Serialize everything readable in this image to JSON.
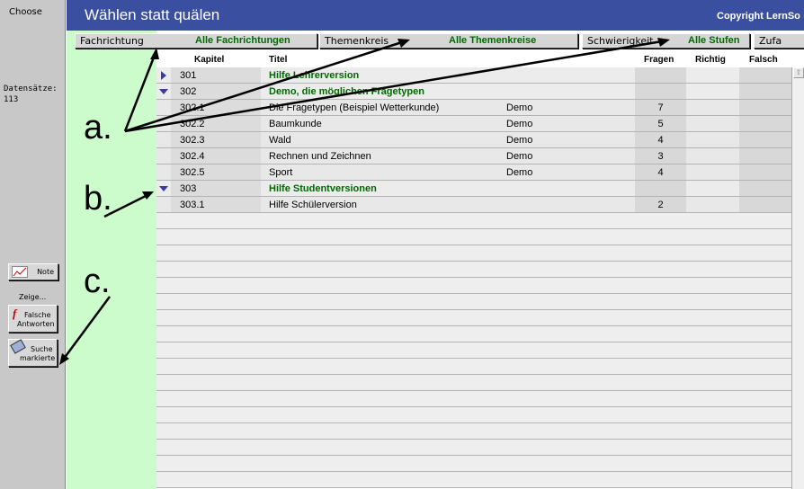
{
  "sidebar": {
    "choose": "Choose",
    "datasaetze_label": "Datensätze:",
    "datasaetze_value": "113",
    "note_label": "Note",
    "zeige_label": "Zeige...",
    "falsche_line1": "Falsche",
    "falsche_line2": "Antworten",
    "suche_line1": "Suche",
    "suche_line2": "markierte"
  },
  "header": {
    "title": "Wählen statt quälen",
    "copyright": "Copyright LernSo"
  },
  "filters": {
    "fachrichtung_label": "Fachrichtung",
    "fachrichtung_value": "Alle Fachrichtungen",
    "themenkreis_label": "Themenkreis",
    "themenkreis_value": "Alle Themenkreise",
    "schwierigkeit_label": "Schwierigkeit",
    "schwierigkeit_value": "Alle Stufen",
    "zufall_label": "Zufa"
  },
  "table": {
    "columns": {
      "kapitel": "Kapitel",
      "titel": "Titel",
      "fragen": "Fragen",
      "richtig": "Richtig",
      "falsch": "Falsch"
    },
    "rows": [
      {
        "kapitel": "301",
        "titel": "Hilfe Lehrerversion",
        "typ": "",
        "fragen": "",
        "group": true,
        "expanded": false
      },
      {
        "kapitel": "302",
        "titel": "Demo, die möglichen Fragetypen",
        "typ": "",
        "fragen": "",
        "group": true,
        "expanded": true
      },
      {
        "kapitel": "302.1",
        "titel": "Die Fragetypen (Beispiel Wetterkunde)",
        "typ": "Demo",
        "fragen": "7",
        "group": false
      },
      {
        "kapitel": "302.2",
        "titel": "Baumkunde",
        "typ": "Demo",
        "fragen": "5",
        "group": false
      },
      {
        "kapitel": "302.3",
        "titel": "Wald",
        "typ": "Demo",
        "fragen": "4",
        "group": false
      },
      {
        "kapitel": "302.4",
        "titel": "Rechnen und Zeichnen",
        "typ": "Demo",
        "fragen": "3",
        "group": false
      },
      {
        "kapitel": "302.5",
        "titel": "Sport",
        "typ": "Demo",
        "fragen": "4",
        "group": false
      },
      {
        "kapitel": "303",
        "titel": "Hilfe Studentversionen",
        "typ": "",
        "fragen": "",
        "group": true,
        "expanded": true
      },
      {
        "kapitel": "303.1",
        "titel": "Hilfe Schülerversion",
        "typ": "",
        "fragen": "2",
        "group": false
      }
    ]
  },
  "annotations": {
    "a": "a.",
    "b": "b.",
    "c": "c."
  },
  "colors": {
    "titlebar": "#3a4fa0",
    "green_panel": "#ccfccc",
    "filter_value": "#006a00",
    "expander": "#3a3aa0"
  }
}
